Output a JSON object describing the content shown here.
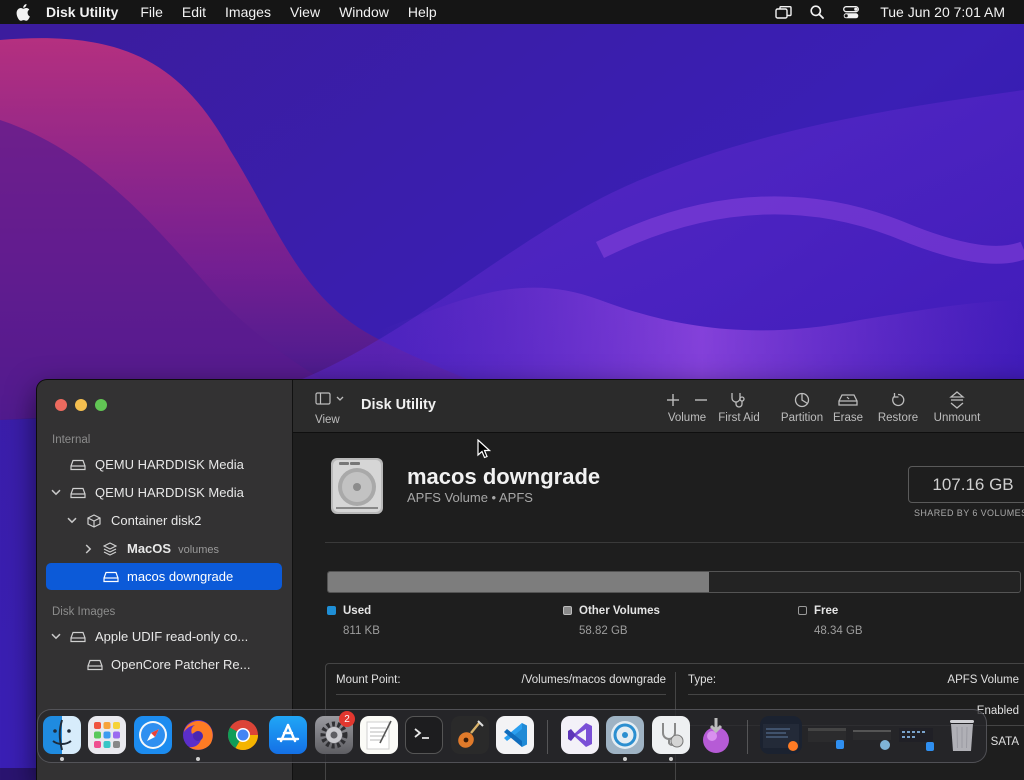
{
  "menubar": {
    "app_name": "Disk Utility",
    "menus": [
      "File",
      "Edit",
      "Images",
      "View",
      "Window",
      "Help"
    ],
    "clock": "Tue Jun 20  7:01 AM",
    "status_icons": [
      "screen-mirroring-icon",
      "search-icon",
      "control-center-icon"
    ]
  },
  "sidebar": {
    "internal_label": "Internal",
    "disk_images_label": "Disk Images",
    "items": [
      {
        "label": "QEMU HARDDISK Media",
        "sub": ""
      },
      {
        "label": "QEMU HARDDISK Media",
        "sub": ""
      },
      {
        "label": "Container disk2",
        "sub": ""
      },
      {
        "label": "MacOS",
        "sub": "volumes"
      },
      {
        "label": "macos downgrade",
        "sub": ""
      },
      {
        "label": "Apple UDIF read-only co...",
        "sub": ""
      },
      {
        "label": "OpenCore Patcher Re...",
        "sub": ""
      }
    ]
  },
  "toolbar": {
    "view_label": "View",
    "title": "Disk Utility",
    "volume_label": "Volume",
    "first_aid_label": "First Aid",
    "partition_label": "Partition",
    "erase_label": "Erase",
    "restore_label": "Restore",
    "unmount_label": "Unmount"
  },
  "volume": {
    "name": "macos downgrade",
    "subtitle": "APFS Volume • APFS",
    "capacity": "107.16 GB",
    "shared_label": "SHARED BY 6 VOLUMES",
    "used_fraction": 0.55
  },
  "legend": [
    {
      "name": "Used",
      "value": "811 KB",
      "color": "#1f8fd6"
    },
    {
      "name": "Other Volumes",
      "value": "58.82 GB",
      "color": "#8a8a8a"
    },
    {
      "name": "Free",
      "value": "48.34 GB",
      "color": "#1e1e1e"
    }
  ],
  "info": {
    "mount_point_label": "Mount Point:",
    "mount_point_value": "/Volumes/macos downgrade",
    "type_label": "Type:",
    "type_value": "APFS Volume",
    "row2_right_value": "Enabled",
    "row3_right_value": "SATA"
  },
  "dock": {
    "apps": [
      "Finder",
      "Launchpad",
      "Safari",
      "Firefox",
      "Chrome",
      "App Store",
      "System Settings",
      "TextEdit",
      "Terminal",
      "GarageBand",
      "VS Code",
      "Visual Studio",
      "Disk Utility",
      "Migration Assistant",
      "Installer",
      "Window 1",
      "Window 2",
      "Window 3",
      "Window 4",
      "Trash"
    ],
    "settings_badge": "2"
  }
}
